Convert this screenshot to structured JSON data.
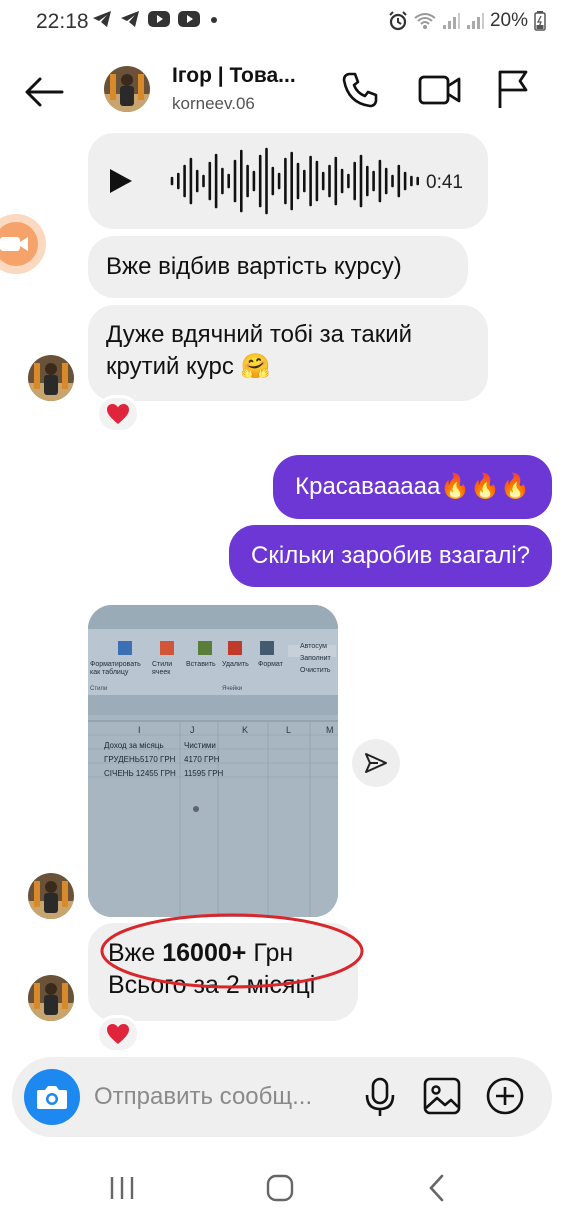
{
  "status_bar": {
    "time": "22:18",
    "battery": "20%",
    "left_icons": [
      "telegram-icon",
      "telegram-icon",
      "youtube-icon",
      "youtube-icon",
      "dot-icon"
    ],
    "right_icons": [
      "alarm-icon",
      "wifi-icon",
      "signal-icon",
      "signal-icon",
      "battery-icon"
    ]
  },
  "header": {
    "name": "Ігор | Това...",
    "username": "korneev.06"
  },
  "messages": {
    "voice": {
      "duration": "0:41"
    },
    "msg1": "Вже відбив вартість курсу)",
    "msg2": "Дуже вдячний тобі за такий крутий курс 🤗",
    "out1": "Красавааааа🔥🔥🔥",
    "out2": "Скільки заробив взагалі?",
    "msg3_prefix": "Вже ",
    "msg3_bold": "16000+",
    "msg3_suffix": " Грн",
    "msg3_line2": "Всього за 2 місяці",
    "reaction": "❤️"
  },
  "photo": {
    "ribbon_buttons": [
      "Форматировать как таблицу",
      "Стили ячеек",
      "Вставить",
      "Удалить",
      "Формат"
    ],
    "ribbon_right": [
      "Автосум",
      "Заполнит",
      "Очистить"
    ],
    "group_labels": [
      "Стили",
      "Ячейки"
    ],
    "columns": [
      "I",
      "J",
      "K",
      "L",
      "M"
    ],
    "table_header": [
      "Доход за місяць",
      "Чистими"
    ],
    "rows": [
      [
        "ГРУДЕНЬ5170 ГРН",
        "4170 ГРН"
      ],
      [
        "СІЧЕНЬ 12455 ГРН",
        "11595 ГРН"
      ]
    ]
  },
  "composer": {
    "placeholder": "Отправить сообщ..."
  },
  "colors": {
    "outgoing_bubble": "#6d37d6",
    "incoming_bubble": "#efeff0",
    "camera_button": "#1d88f0",
    "annotation_circle": "#d9262a",
    "reaction_heart": "#e0243b"
  }
}
